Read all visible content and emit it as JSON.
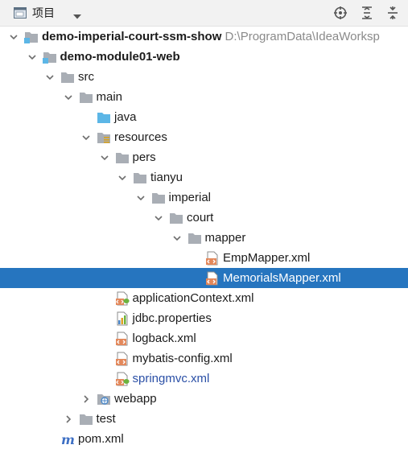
{
  "toolbar": {
    "project_label": "项目"
  },
  "tree": [
    {
      "label": "demo-imperial-court-ssm-show",
      "hint": "D:\\ProgramData\\IdeaWorksp",
      "icon": "module-icon",
      "arrow": "down",
      "level": 0,
      "bold": true
    },
    {
      "label": "demo-module01-web",
      "icon": "module-icon",
      "arrow": "down",
      "level": 1,
      "bold": true
    },
    {
      "label": "src",
      "icon": "folder-icon",
      "arrow": "down",
      "level": 2
    },
    {
      "label": "main",
      "icon": "folder-icon",
      "arrow": "down",
      "level": 3
    },
    {
      "label": "java",
      "icon": "source-folder-icon",
      "arrow": "none",
      "level": 4
    },
    {
      "label": "resources",
      "icon": "resources-folder-icon",
      "arrow": "down",
      "level": 4
    },
    {
      "label": "pers",
      "icon": "folder-icon",
      "arrow": "down",
      "level": 5
    },
    {
      "label": "tianyu",
      "icon": "folder-icon",
      "arrow": "down",
      "level": 6
    },
    {
      "label": "imperial",
      "icon": "folder-icon",
      "arrow": "down",
      "level": 7
    },
    {
      "label": "court",
      "icon": "folder-icon",
      "arrow": "down",
      "level": 8
    },
    {
      "label": "mapper",
      "icon": "folder-icon",
      "arrow": "down",
      "level": 9
    },
    {
      "label": "EmpMapper.xml",
      "icon": "xml-file-icon",
      "arrow": "none",
      "level": 10
    },
    {
      "label": "MemorialsMapper.xml",
      "icon": "xml-file-icon",
      "arrow": "none",
      "level": 10,
      "selected": true
    },
    {
      "label": "applicationContext.xml",
      "icon": "spring-xml-icon",
      "arrow": "none",
      "level": 5
    },
    {
      "label": "jdbc.properties",
      "icon": "properties-file-icon",
      "arrow": "none",
      "level": 5
    },
    {
      "label": "logback.xml",
      "icon": "xml-file-icon",
      "arrow": "none",
      "level": 5
    },
    {
      "label": "mybatis-config.xml",
      "icon": "xml-file-icon",
      "arrow": "none",
      "level": 5
    },
    {
      "label": "springmvc.xml",
      "icon": "spring-xml-icon",
      "arrow": "none",
      "level": 5,
      "modified": true
    },
    {
      "label": "webapp",
      "icon": "web-folder-icon",
      "arrow": "right",
      "level": 4
    },
    {
      "label": "test",
      "icon": "folder-icon",
      "arrow": "right",
      "level": 3
    },
    {
      "label": "pom.xml",
      "icon": "maven-icon",
      "arrow": "none",
      "level": 2
    }
  ],
  "colors": {
    "selection": "#2675bf",
    "folder": "#a9aeb5",
    "source_folder": "#5cb6e6",
    "xml_orange": "#e3885b",
    "spring_green": "#6cb33e",
    "maven_blue": "#3d6fc4",
    "modified_text": "#2a4fa6"
  }
}
